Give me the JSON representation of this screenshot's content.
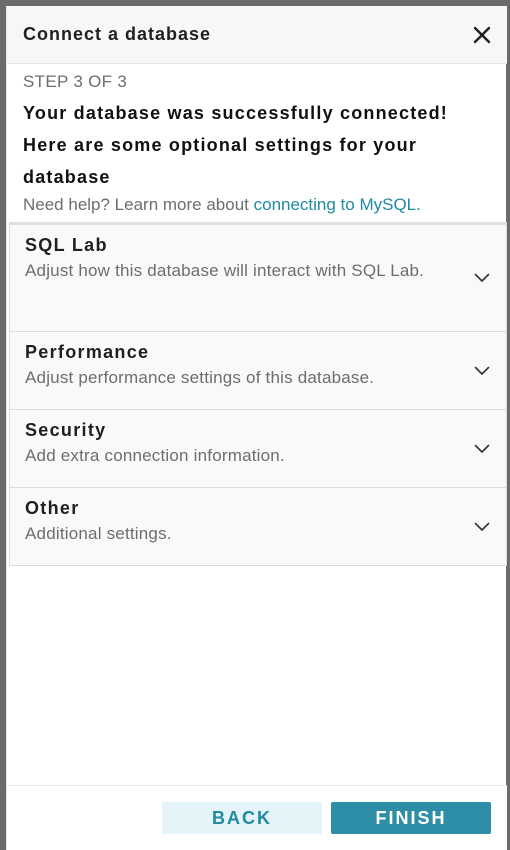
{
  "modal": {
    "title": "Connect a database",
    "close_icon": "close-icon"
  },
  "info": {
    "step": "STEP 3 OF 3",
    "success_message": "Your database was successfully connected! Here are some optional settings for your database",
    "help_prefix": "Need help? Learn more about ",
    "help_link": "connecting to MySQL."
  },
  "panels": [
    {
      "title": "SQL Lab",
      "description": "Adjust how this database will interact with SQL Lab.",
      "icon": "chevron-down-icon"
    },
    {
      "title": "Performance",
      "description": "Adjust performance settings of this database.",
      "icon": "chevron-down-icon"
    },
    {
      "title": "Security",
      "description": "Add extra connection information.",
      "icon": "chevron-down-icon"
    },
    {
      "title": "Other",
      "description": "Additional settings.",
      "icon": "chevron-down-icon"
    }
  ],
  "footer": {
    "back_label": "BACK",
    "finish_label": "FINISH"
  },
  "colors": {
    "accent": "#1f8aa0",
    "primary_button": "#2f8ea7",
    "secondary_button_bg": "#e5f4f8",
    "header_bg": "#f7f7f7",
    "panel_bg": "#f9f9f9"
  }
}
